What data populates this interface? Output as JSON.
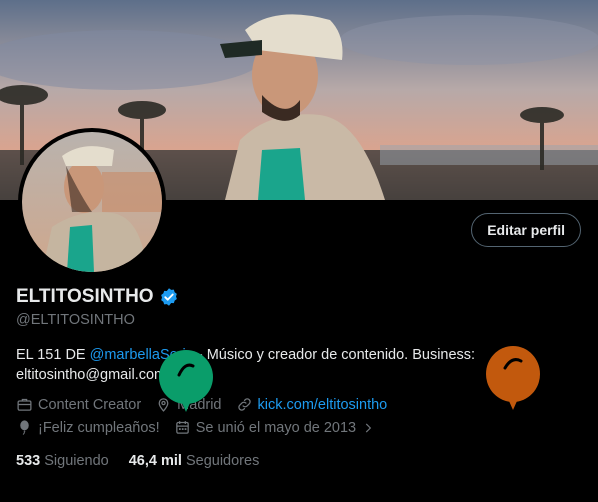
{
  "profile": {
    "display_name": "ELTITOSINTHO",
    "handle": "@ELTITOSINTHO",
    "edit_button": "Editar perfil",
    "bio_prefix": "EL 151 DE ",
    "bio_mention": "@marbellaSerie",
    "bio_suffix": " - Músico y creador de contenido. Business: eltitosintho@gmail.com",
    "category": "Content Creator",
    "location": "Madrid",
    "website": "kick.com/eltitosintho",
    "birthday": "¡Feliz cumpleaños!",
    "joined": "Se unió el mayo de 2013",
    "following_count": "533",
    "following_label": "Siguiendo",
    "followers_count": "46,4 mil",
    "followers_label": "Seguidores"
  },
  "colors": {
    "accent": "#1d9bf0",
    "verified": "#1d9bf0",
    "balloon_green": "#0a9d6a",
    "balloon_orange": "#c2590d"
  }
}
